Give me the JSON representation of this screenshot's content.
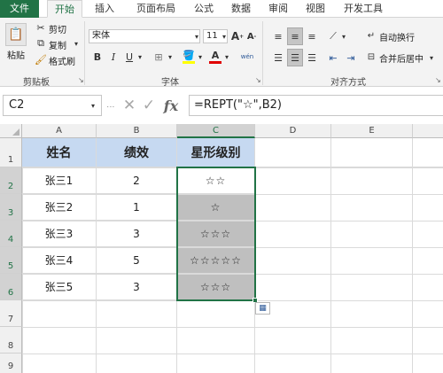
{
  "tabs": [
    "文件",
    "开始",
    "插入",
    "页面布局",
    "公式",
    "数据",
    "审阅",
    "视图",
    "开发工具"
  ],
  "clipboard": {
    "paste_label": "粘贴",
    "cut_label": "剪切",
    "copy_label": "复制",
    "format_painter_label": "格式刷",
    "group_label": "剪贴板"
  },
  "font": {
    "name": "宋体",
    "size": "11",
    "group_label": "字体",
    "bold": "B",
    "italic": "I",
    "underline": "U",
    "grow": "A",
    "shrink": "A",
    "color_a": "A",
    "wen": "wén"
  },
  "alignment": {
    "wrap_text_label": "自动换行",
    "merge_center_label": "合并后居中",
    "group_label": "对齐方式"
  },
  "formula_bar": {
    "name_box": "C2",
    "fx": "fx",
    "formula": "=REPT(\"☆\",B2)"
  },
  "columns": [
    "A",
    "B",
    "C",
    "D",
    "E"
  ],
  "rows": [
    "1",
    "2",
    "3",
    "4",
    "5",
    "6",
    "7",
    "8",
    "9"
  ],
  "table": {
    "headers": [
      "姓名",
      "绩效",
      "星形级别"
    ],
    "rows": [
      [
        "张三1",
        "2",
        "☆☆"
      ],
      [
        "张三2",
        "1",
        "☆"
      ],
      [
        "张三3",
        "3",
        "☆☆☆"
      ],
      [
        "张三4",
        "5",
        "☆☆☆☆☆"
      ],
      [
        "张三5",
        "3",
        "☆☆☆"
      ]
    ]
  },
  "colors": {
    "accent": "#217346",
    "header_fill": "#c6d9f1",
    "selection_fill": "#bfbfbf"
  }
}
